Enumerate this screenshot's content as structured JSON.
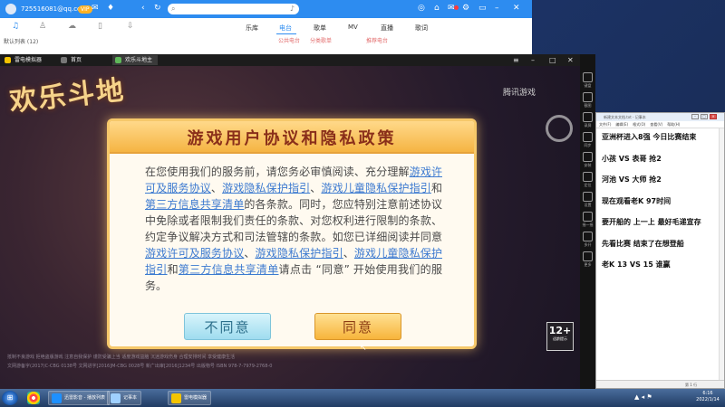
{
  "music_player": {
    "username": "725516081@qq.com",
    "vip_label": "VIP",
    "search_placeholder": "",
    "nav_tabs": [
      {
        "label": "乐库",
        "sub": ""
      },
      {
        "label": "电台",
        "sub": "公共电台"
      },
      {
        "label": "歌单",
        "sub": "分类歌单"
      },
      {
        "label": "MV",
        "sub": ""
      },
      {
        "label": "直播",
        "sub": "推荐电台"
      },
      {
        "label": "歌词",
        "sub": ""
      }
    ],
    "playlist_label": "默认列表 (12)"
  },
  "emulator": {
    "tabs": [
      {
        "label": "雷电模拟器"
      },
      {
        "label": "首页"
      },
      {
        "label": "欢乐斗地主"
      }
    ],
    "side_buttons": [
      "键盘",
      "截图",
      "录屏",
      "同步",
      "安装",
      "定位",
      "设置",
      "摇一摇",
      "多开",
      "更多"
    ]
  },
  "game": {
    "logo_text": "欢乐斗地",
    "brand_text": "腾讯游戏",
    "rating": "12+",
    "rating_sub": "适龄提示",
    "footer_lines": [
      "抵制不良游戏 拒绝盗版游戏 注意自我保护 谨防受骗上当 适度游戏益脑 沉迷游戏伤身 合理安排时间 享受健康生活",
      "文网游备字(2017)C-CBG 0138号 文网进字[2016]M-CBG 0028号 新广出审[2016]1234号 出版物号 ISBN 978-7-7979-2768-0"
    ],
    "dialog": {
      "title": "游戏用户协议和隐私政策",
      "body": [
        {
          "t": "在您使用我们的服务前，请您务必审慎阅读、充分理解",
          "link": false
        },
        {
          "t": "游戏许可及服务协议",
          "link": true
        },
        {
          "t": "、",
          "link": false
        },
        {
          "t": "游戏隐私保护指引",
          "link": true
        },
        {
          "t": "、",
          "link": false
        },
        {
          "t": "游戏儿童隐私保护指引",
          "link": true
        },
        {
          "t": "和",
          "link": false
        },
        {
          "t": "第三方信息共享清单",
          "link": true
        },
        {
          "t": "的各条款。同时，您应特别注意前述协议中免除或者限制我们责任的条款、对您权利进行限制的条款、约定争议解决方式和司法管辖的条款。如您已详细阅读并同意",
          "link": false
        },
        {
          "t": "游戏许可及服务协议",
          "link": true
        },
        {
          "t": "、",
          "link": false
        },
        {
          "t": "游戏隐私保护指引",
          "link": true
        },
        {
          "t": "、",
          "link": false
        },
        {
          "t": "游戏儿童隐私保护指引",
          "link": true
        },
        {
          "t": "和",
          "link": false
        },
        {
          "t": "第三方信息共享清单",
          "link": true
        },
        {
          "t": "请点击 “同意” 开始使用我们的服务。",
          "link": false
        }
      ],
      "disagree_label": "不同意",
      "agree_label": "同意"
    }
  },
  "notepad": {
    "title": "新建文本文档.txt - 记事本",
    "menu": [
      "文件(F)",
      "编辑(E)",
      "格式(O)",
      "查看(V)",
      "帮助(H)"
    ],
    "lines": [
      "亚洲杯进入8强 今日比赛结束",
      "小孩 VS 表哥  抢2",
      "河池 VS 大师  抢2",
      "现在观看老K 97时间",
      "要开船的 上一上 最好毛递宣存",
      "先看比赛 结束了在想登船",
      "老K 13 VS 15 谁赢"
    ],
    "status": "第 1 行"
  },
  "taskbar": {
    "tasks": [
      {
        "label": "迅雷影音 - 播放列表",
        "color": "#1e90ff"
      },
      {
        "label": "记事本",
        "color": "#9fd0ff"
      },
      {
        "label": "雷电模拟器",
        "color": "#f5c400"
      }
    ],
    "clock_time": "6:16",
    "clock_date": "2022/1/14"
  },
  "colors": {
    "music_accent": "#2d8cf0",
    "dialog_title": "#8a2f1a",
    "dialog_link": "#3c7ad0",
    "agree_button": "#f7b43b",
    "disagree_button": "#9fdcef"
  }
}
